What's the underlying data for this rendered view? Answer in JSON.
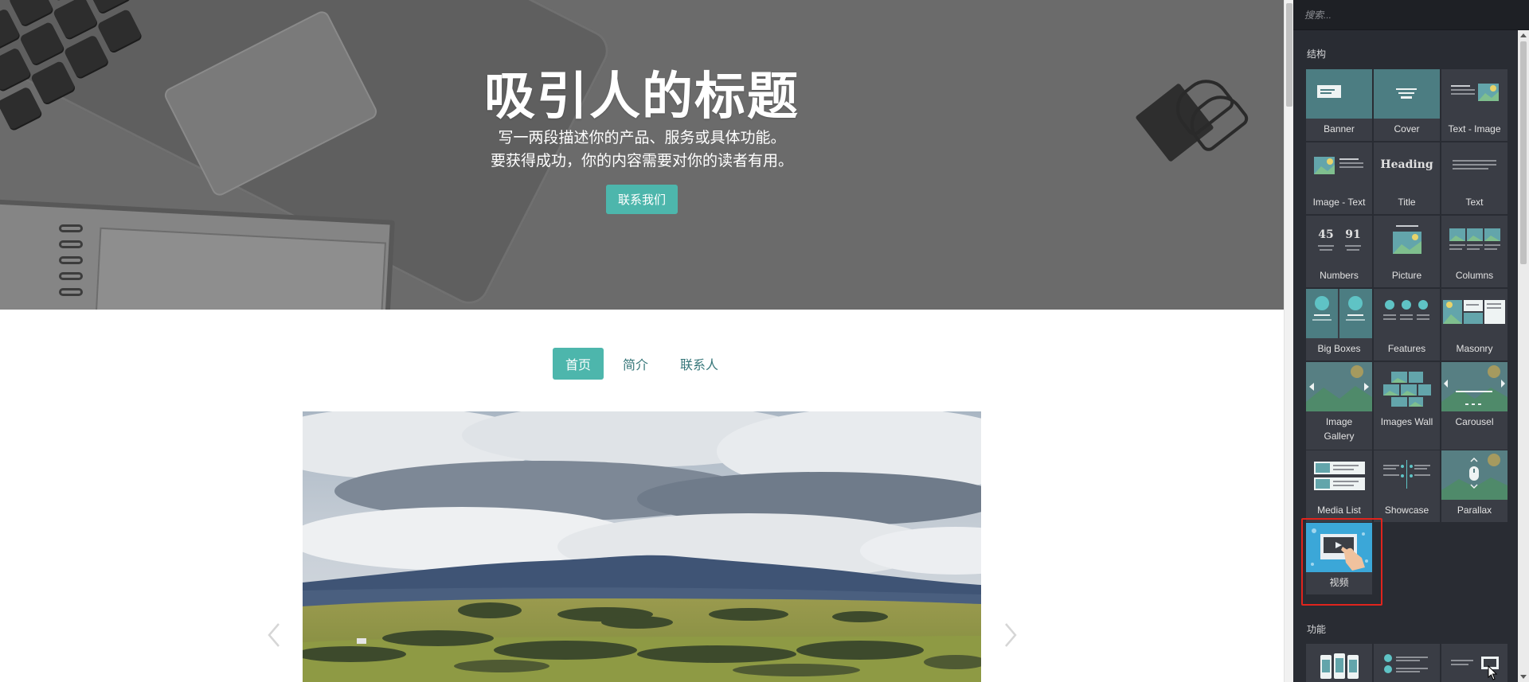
{
  "hero": {
    "title": "吸引人的标题",
    "line1": "写一两段描述你的产品、服务或具体功能。",
    "line2": "要获得成功，你的内容需要对你的读者有用。",
    "cta_label": "联系我们"
  },
  "nav": {
    "items": [
      {
        "label": "首页",
        "active": true
      },
      {
        "label": "简介",
        "active": false
      },
      {
        "label": "联系人",
        "active": false
      }
    ]
  },
  "panel": {
    "search_placeholder": "搜索...",
    "structure_label": "结构",
    "features_label": "功能",
    "blocks": [
      {
        "label": "Banner"
      },
      {
        "label": "Cover"
      },
      {
        "label": "Text - Image"
      },
      {
        "label": "Image - Text"
      },
      {
        "label": "Title",
        "thumb_text": "Heading"
      },
      {
        "label": "Text"
      },
      {
        "label": "Numbers",
        "thumb_text_1": "45",
        "thumb_text_2": "91"
      },
      {
        "label": "Picture"
      },
      {
        "label": "Columns"
      },
      {
        "label": "Big Boxes"
      },
      {
        "label": "Features"
      },
      {
        "label": "Masonry"
      },
      {
        "label": "Image Gallery"
      },
      {
        "label": "Images Wall"
      },
      {
        "label": "Carousel"
      },
      {
        "label": "Media List"
      },
      {
        "label": "Showcase"
      },
      {
        "label": "Parallax"
      },
      {
        "label": "视频",
        "highlighted": true
      }
    ]
  },
  "colors": {
    "accent": "#4db6ac",
    "panel_bg": "#292c33",
    "highlight": "#e0241d"
  }
}
